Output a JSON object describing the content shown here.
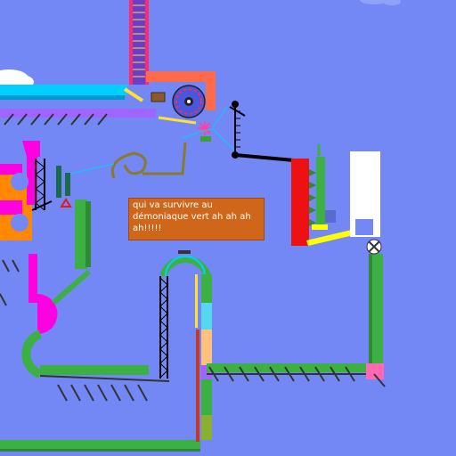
{
  "comment": {
    "text": "qui va survivre au démoniaque vert ah ah ah ah!!!!!",
    "background": "#d0661a",
    "text_color": "#ffffff"
  },
  "colors": {
    "sky": "#7388f4",
    "track_green": "#3cb043",
    "magenta": "#ff00e0",
    "cyan_ledge": "#00d0ff",
    "red_block": "#ee1111",
    "orange": "#ff8800",
    "yellow": "#ffff00",
    "white_box": "#ffffff"
  },
  "icons": [
    "cloud-icon",
    "spinning-wheel-icon",
    "star-burst-icon",
    "ball-icon",
    "warning-triangle-icon",
    "chain-ladder-icon",
    "pinwheel-icon"
  ]
}
